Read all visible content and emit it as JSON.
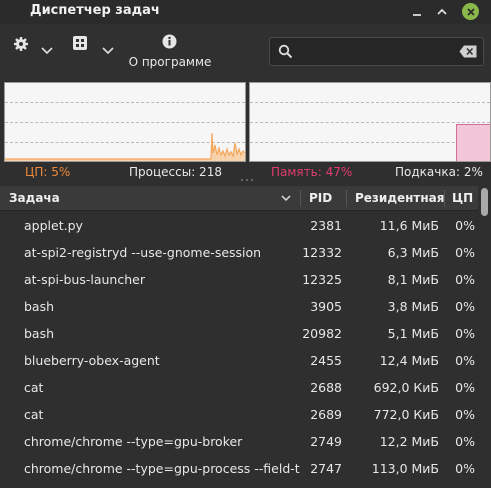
{
  "window": {
    "title": "Диспетчер задач"
  },
  "toolbar": {
    "about_label": "О программе",
    "search_placeholder": ""
  },
  "graphs": {
    "cpu_color": "#f5a55a",
    "mem_color": "#e37ea8",
    "mem_fill": "#f2c6d6"
  },
  "stats": {
    "cpu": "ЦП: 5%",
    "processes": "Процессы: 218",
    "memory": "Память: 47%",
    "swap": "Подкачка: 2%"
  },
  "colors": {
    "cpu_text": "#f08a3a",
    "mem_text": "#e03d6e"
  },
  "table": {
    "headers": {
      "task": "Задача",
      "pid": "PID",
      "resident": "Резидентная",
      "cpu": "ЦП"
    },
    "rows": [
      {
        "name": "applet.py",
        "pid": "2381",
        "res": "11,6 МиБ",
        "cpu": "0%"
      },
      {
        "name": "at-spi2-registryd --use-gnome-session",
        "pid": "12332",
        "res": "6,3 МиБ",
        "cpu": "0%"
      },
      {
        "name": "at-spi-bus-launcher",
        "pid": "12325",
        "res": "8,1 МиБ",
        "cpu": "0%"
      },
      {
        "name": "bash",
        "pid": "3905",
        "res": "3,8 МиБ",
        "cpu": "0%"
      },
      {
        "name": "bash",
        "pid": "20982",
        "res": "5,1 МиБ",
        "cpu": "0%"
      },
      {
        "name": "blueberry-obex-agent",
        "pid": "2455",
        "res": "12,4 МиБ",
        "cpu": "0%"
      },
      {
        "name": "cat",
        "pid": "2688",
        "res": "692,0 КиБ",
        "cpu": "0%"
      },
      {
        "name": "cat",
        "pid": "2689",
        "res": "772,0 КиБ",
        "cpu": "0%"
      },
      {
        "name": "chrome/chrome --type=gpu-broker",
        "pid": "2749",
        "res": "12,2 МиБ",
        "cpu": "0%"
      },
      {
        "name": "chrome/chrome --type=gpu-process --field-trial...",
        "pid": "2747",
        "res": "113,0 МиБ",
        "cpu": "0%"
      }
    ]
  }
}
